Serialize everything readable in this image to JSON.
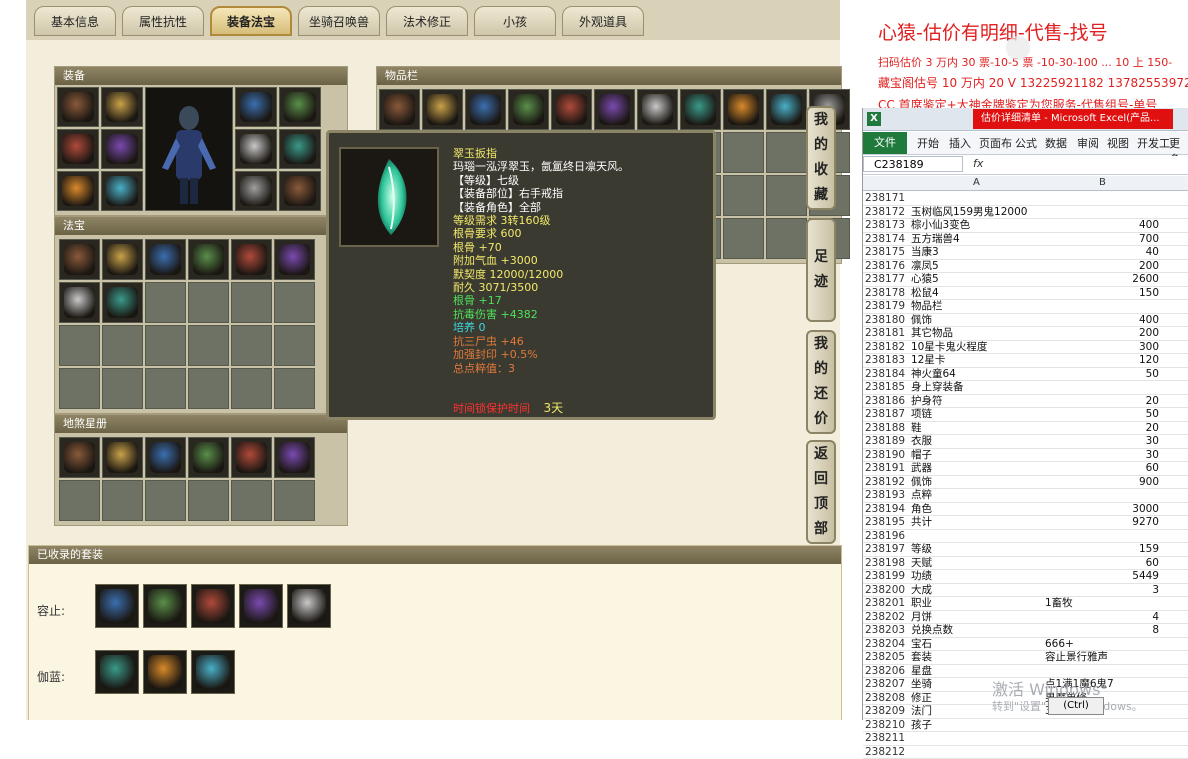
{
  "tabs": [
    "基本信息",
    "属性抗性",
    "装备法宝",
    "坐骑召唤兽",
    "法术修正",
    "小孩",
    "外观道具"
  ],
  "active_tab_index": 2,
  "panels": {
    "equip": "装备",
    "items": "物品栏",
    "fabao": "法宝",
    "dilian": "地煞星册",
    "suits": "已收录的套装"
  },
  "suit_rows": [
    {
      "label": "容止:"
    },
    {
      "label": "伽蓝:"
    }
  ],
  "side_buttons": [
    [
      "我",
      "的",
      "收",
      "藏"
    ],
    [
      "足",
      "迹"
    ],
    [
      "我",
      "的",
      "还",
      "价"
    ],
    [
      "返",
      "回",
      "顶",
      "部"
    ]
  ],
  "tooltip": {
    "name": "翠玉扳指",
    "lines": [
      {
        "text": "玛瑙一泓浮翠玉，氤氲终日凛天风。",
        "color": "#ffffff"
      },
      {
        "text": "【等级】七级",
        "color": "#ffffff"
      },
      {
        "text": "【装备部位】右手戒指",
        "color": "#ffffff"
      },
      {
        "text": "【装备角色】全部",
        "color": "#ffffff"
      },
      {
        "text": "等级需求 3转160级",
        "color": "#f2e96a"
      },
      {
        "text": "根骨要求 600",
        "color": "#f2e96a"
      },
      {
        "text": "根骨 +70",
        "color": "#f2e96a"
      },
      {
        "text": "附加气血 +3000",
        "color": "#f2e96a"
      },
      {
        "text": "默契度 12000/12000",
        "color": "#f2e96a"
      },
      {
        "text": "耐久 3071/3500",
        "color": "#f2e96a"
      },
      {
        "text": "根骨 +17",
        "color": "#4fe05a"
      },
      {
        "text": "抗毒伤害 +4382",
        "color": "#4fe05a"
      },
      {
        "text": "培养 0",
        "color": "#3fd9e0"
      },
      {
        "text": "抗三尸虫 +46",
        "color": "#e07a3a"
      },
      {
        "text": "加强封印 +0.5%",
        "color": "#e07a3a"
      },
      {
        "text": "总点粹值：3",
        "color": "#e07a3a"
      }
    ],
    "protect_label": "时间锁保护时间",
    "protect_value": "3天",
    "protect_label_color": "#ff3030",
    "protect_value_color": "#f2e96a"
  },
  "promo": {
    "line1": "心猿-估价有明细-代售-找号",
    "line2": "扫码估价 3 万内 30 票-10-5 票 -10-30-100 ... 10 上 150-",
    "line3": "藏宝阁估号 10 万内 20 V 13225921182 13782553972",
    "line4": "CC 首席鉴定+大神金牌鉴定为您服务-代售组号-单号"
  },
  "excel": {
    "title_icon": "X",
    "window_title": "估价详细清单 - Microsoft Excel(产品...",
    "ribbon": [
      "文件",
      "开始",
      "插入",
      "页面布",
      "公式",
      "数据",
      "审阅",
      "视图",
      "开发工",
      "更多"
    ],
    "name_box": "C238189",
    "fx": "fx",
    "col_a": "A",
    "col_b": "B",
    "rows": [
      {
        "n": "238171",
        "a": "",
        "b": ""
      },
      {
        "n": "238172",
        "a": "玉树临风159男鬼12000",
        "b": ""
      },
      {
        "n": "238173",
        "a": "棕小仙3变色",
        "b": "400"
      },
      {
        "n": "238174",
        "a": "五方瑞兽4",
        "b": "700"
      },
      {
        "n": "238175",
        "a": "当康3",
        "b": "40"
      },
      {
        "n": "238176",
        "a": "凛凤5",
        "b": "200"
      },
      {
        "n": "238177",
        "a": "心猿5",
        "b": "2600"
      },
      {
        "n": "238178",
        "a": "松鼠4",
        "b": "150"
      },
      {
        "n": "238179",
        "a": "物品栏",
        "b": ""
      },
      {
        "n": "238180",
        "a": "佩饰",
        "b": "400"
      },
      {
        "n": "238181",
        "a": "其它物品",
        "b": "200"
      },
      {
        "n": "238182",
        "a": "10星卡鬼火程度",
        "b": "300"
      },
      {
        "n": "238183",
        "a": "12星卡",
        "b": "120"
      },
      {
        "n": "238184",
        "a": "神火童64",
        "b": "50"
      },
      {
        "n": "238185",
        "a": "身上穿装备",
        "b": ""
      },
      {
        "n": "238186",
        "a": "护身符",
        "b": "20"
      },
      {
        "n": "238187",
        "a": "项链",
        "b": "50"
      },
      {
        "n": "238188",
        "a": "鞋",
        "b": "20"
      },
      {
        "n": "238189",
        "a": "衣服",
        "b": "30"
      },
      {
        "n": "238190",
        "a": "帽子",
        "b": "30"
      },
      {
        "n": "238191",
        "a": "武器",
        "b": "60"
      },
      {
        "n": "238192",
        "a": "佩饰",
        "b": "900"
      },
      {
        "n": "238193",
        "a": "点粹",
        "b": ""
      },
      {
        "n": "238194",
        "a": "角色",
        "b": "3000"
      },
      {
        "n": "238195",
        "a": "共计",
        "b": "9270"
      },
      {
        "n": "238196",
        "a": "",
        "b": ""
      },
      {
        "n": "238197",
        "a": "等级",
        "b": "159"
      },
      {
        "n": "238198",
        "a": "天赋",
        "b": "60"
      },
      {
        "n": "238199",
        "a": "功绩",
        "b": "5449"
      },
      {
        "n": "238200",
        "a": "大成",
        "b": "3"
      },
      {
        "n": "238201",
        "a": "职业",
        "b": "1畜牧"
      },
      {
        "n": "238202",
        "a": "月饼",
        "b": "4"
      },
      {
        "n": "238203",
        "a": "兑换点数",
        "b": "8"
      },
      {
        "n": "238204",
        "a": "宝石",
        "b": "666+"
      },
      {
        "n": "238205",
        "a": "套装",
        "b": "容止景行雅声"
      },
      {
        "n": "238206",
        "a": "星盘",
        "b": ""
      },
      {
        "n": "238207",
        "a": "坐骑",
        "b": "点1满1魔6鬼7"
      },
      {
        "n": "238208",
        "a": "修正",
        "b": "男魔单修"
      },
      {
        "n": "238209",
        "a": "法门",
        "b": "3311-2551"
      },
      {
        "n": "238210",
        "a": "孩子",
        "b": ""
      },
      {
        "n": "238211",
        "a": "",
        "b": ""
      },
      {
        "n": "238212",
        "a": "",
        "b": ""
      }
    ]
  },
  "watermark": {
    "line1": "激活 Windows",
    "line2": "转到\"设置\"以激活 Windows。",
    "ctrl": "(Ctrl)"
  },
  "colors": {
    "accent": "#e02020",
    "excel_green": "#1f7a3c",
    "tooltip_bg": "#3b3a31"
  }
}
